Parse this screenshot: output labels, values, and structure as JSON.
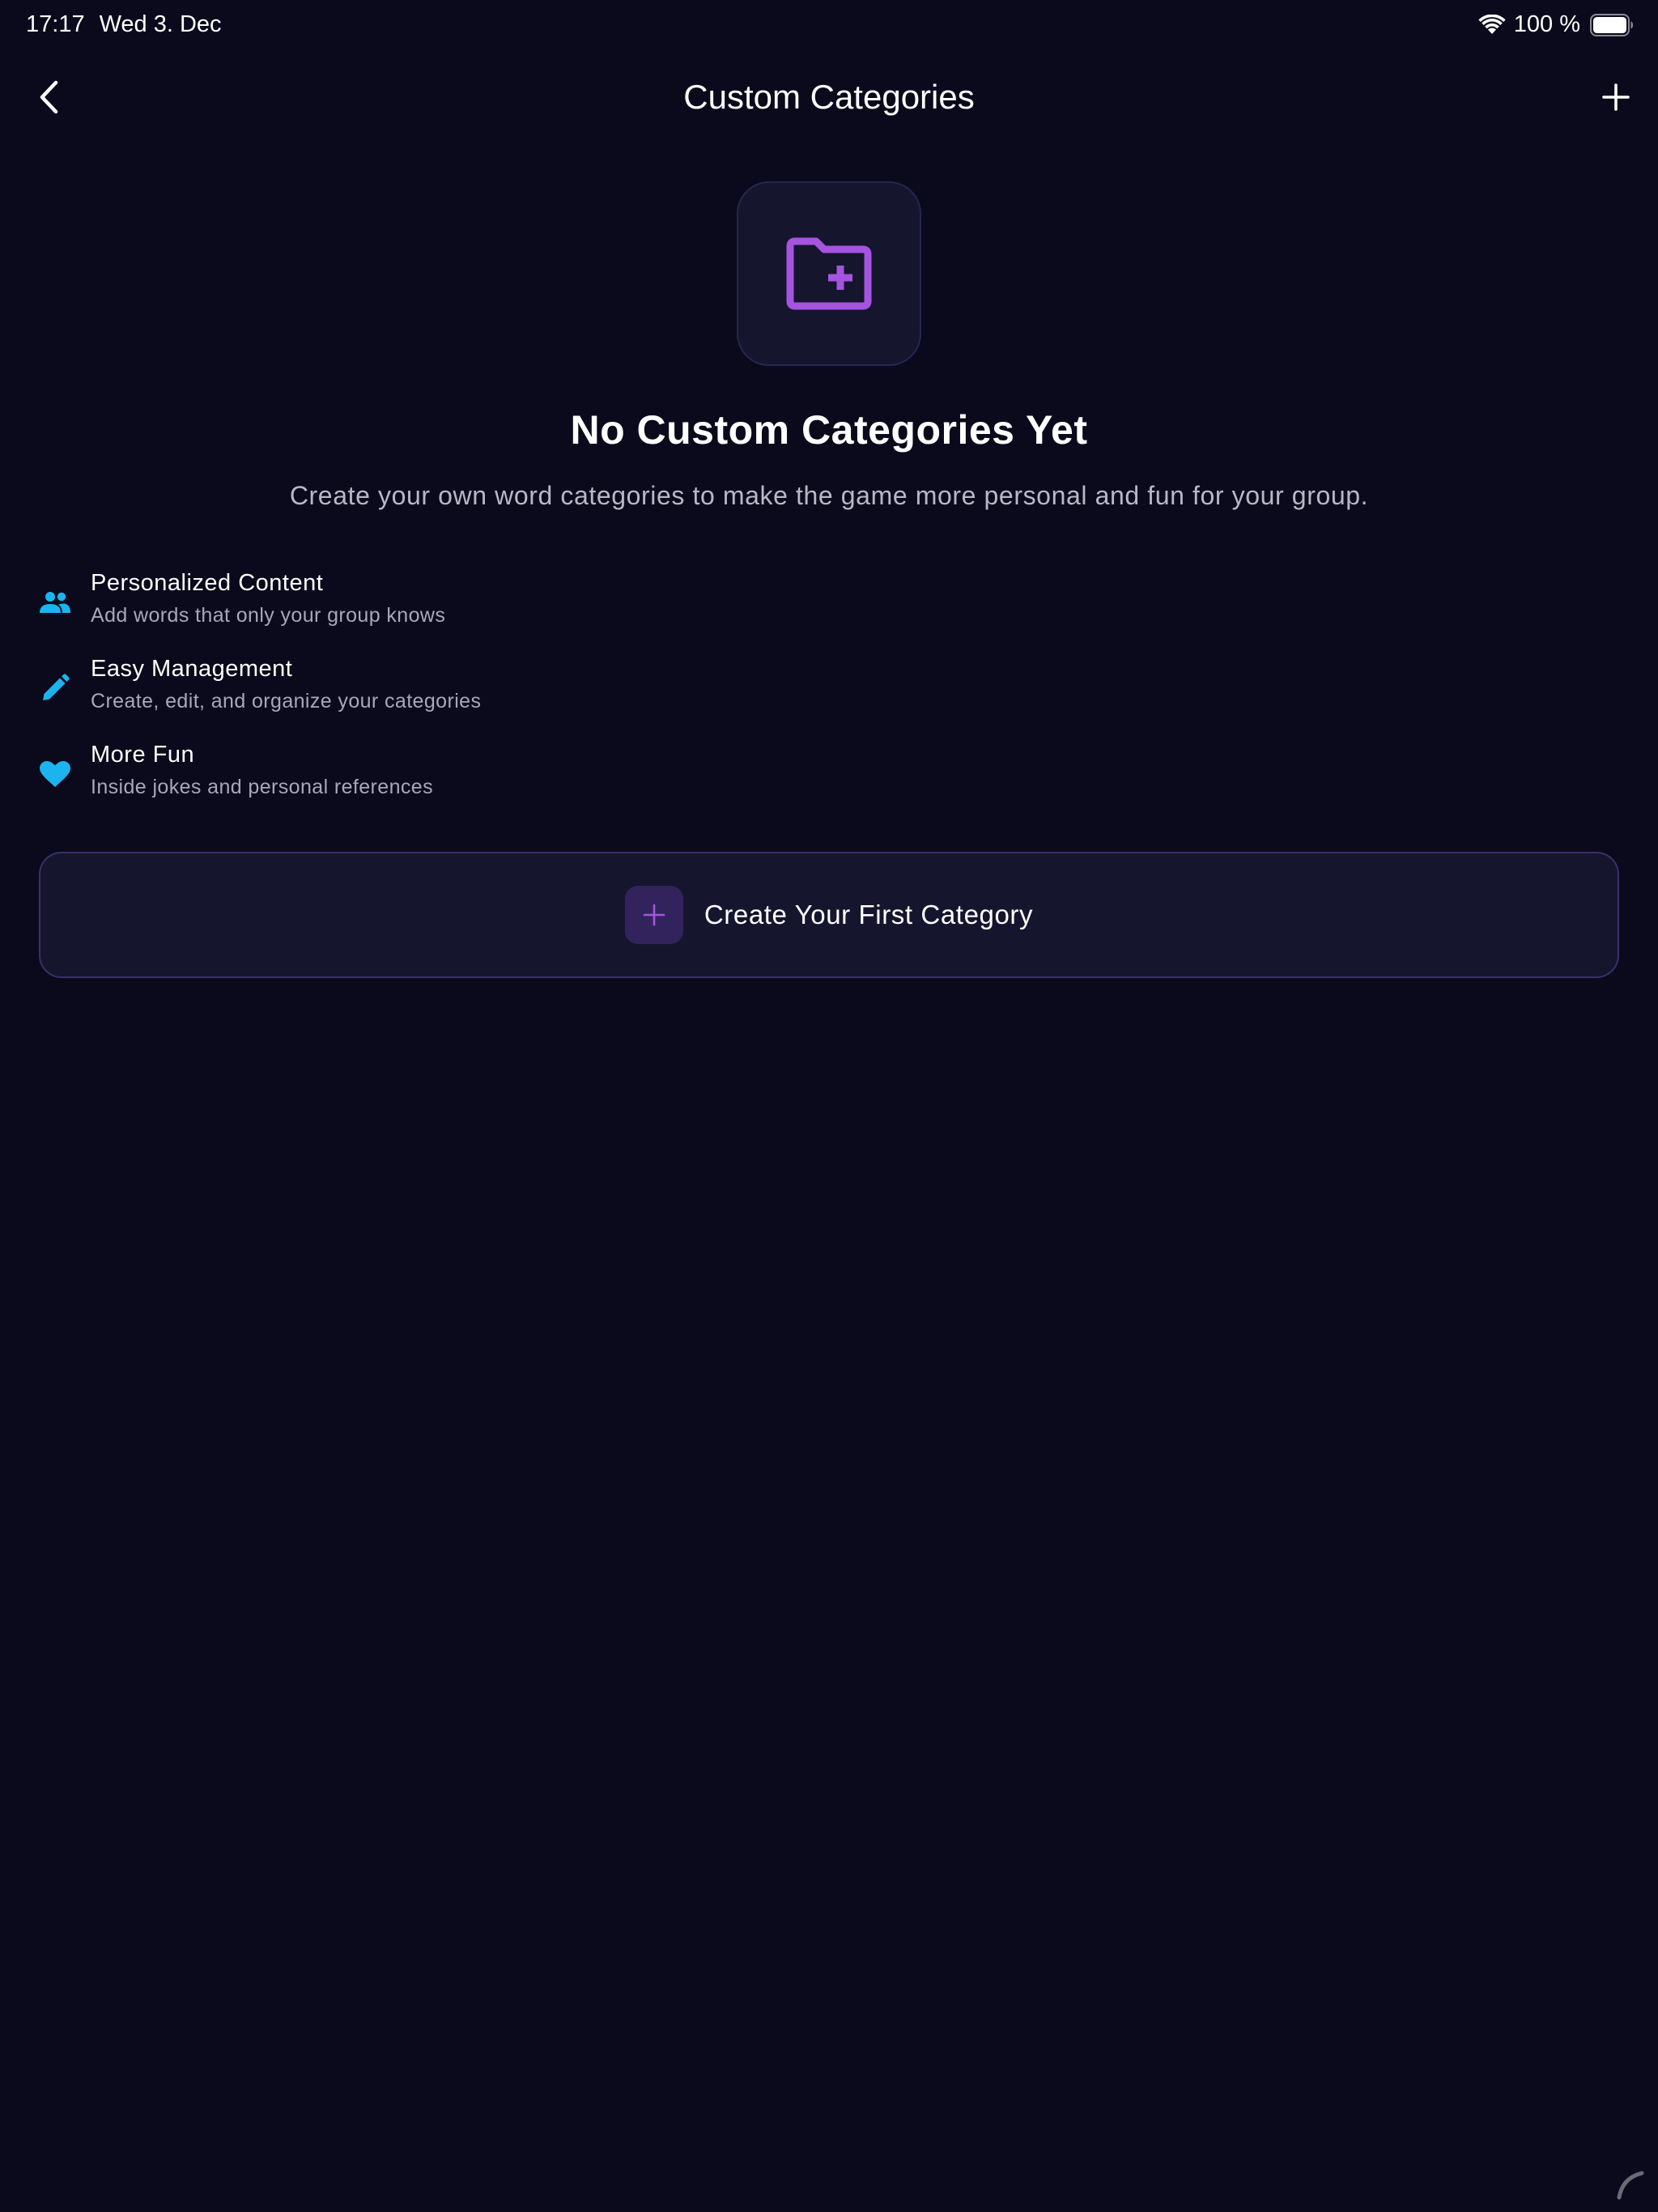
{
  "status_bar": {
    "time": "17:17",
    "date": "Wed 3. Dec",
    "battery_percent": "100 %",
    "icons": [
      "wifi-icon",
      "battery-icon"
    ]
  },
  "nav": {
    "title": "Custom Categories",
    "back_icon": "chevron-left-icon",
    "add_icon": "plus-icon"
  },
  "empty_state": {
    "icon": "folder-plus-icon",
    "title": "No Custom Categories Yet",
    "subtitle": "Create your own word categories to make the game more personal and fun for your group."
  },
  "features": [
    {
      "icon": "people-icon",
      "title": "Personalized Content",
      "description": "Add words that only your group knows"
    },
    {
      "icon": "pencil-icon",
      "title": "Easy Management",
      "description": "Create, edit, and organize your categories"
    },
    {
      "icon": "heart-icon",
      "title": "More Fun",
      "description": "Inside jokes and personal references"
    }
  ],
  "create_button": {
    "label": "Create Your First Category",
    "icon": "plus-icon"
  },
  "colors": {
    "background": "#0a0a1c",
    "card": "#16152e",
    "accent_purple": "#a554e0",
    "accent_cyan": "#1bb4f0",
    "text_secondary": "#b9b7c6"
  }
}
